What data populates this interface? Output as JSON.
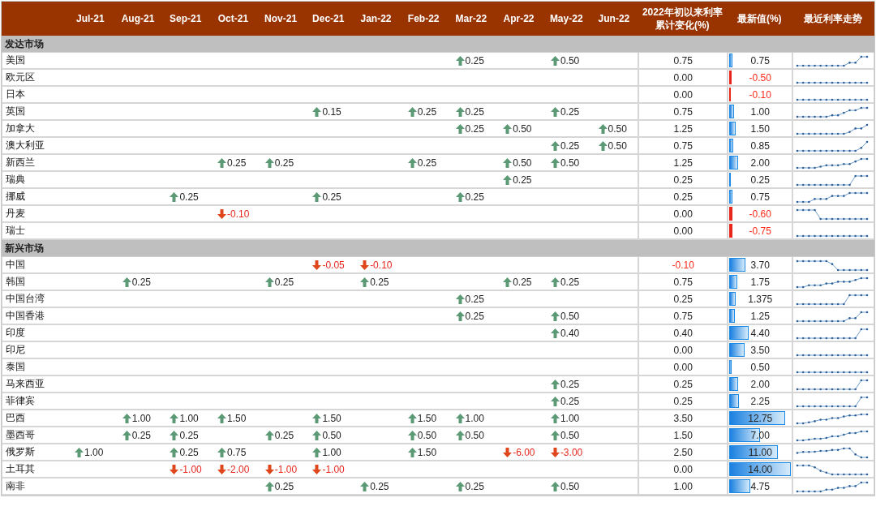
{
  "months": [
    "Jul-21",
    "Aug-21",
    "Sep-21",
    "Oct-21",
    "Nov-21",
    "Dec-21",
    "Jan-22",
    "Feb-22",
    "Mar-22",
    "Apr-22",
    "May-22",
    "Jun-22"
  ],
  "change_header": "2022年初以来利率累计变化(%)",
  "latest_header": "最新值(%)",
  "trend_header": "最近利率走势",
  "sections": [
    {
      "title": "发达市场",
      "rows": [
        {
          "name": "美国",
          "moves": [
            {
              "kind": "none"
            },
            {
              "kind": "none"
            },
            {
              "kind": "none"
            },
            {
              "kind": "none"
            },
            {
              "kind": "none"
            },
            {
              "kind": "none"
            },
            {
              "kind": "none"
            },
            {
              "kind": "none"
            },
            {
              "kind": "rise",
              "value": "0.25"
            },
            {
              "kind": "none"
            },
            {
              "kind": "rise",
              "value": "0.50"
            },
            {
              "kind": "none"
            }
          ],
          "change": {
            "text": "0.75",
            "negative": false
          },
          "latest": {
            "text": "0.75",
            "negative": false,
            "level": 0.054
          }
        },
        {
          "name": "欧元区",
          "moves": [
            {
              "kind": "none"
            },
            {
              "kind": "none"
            },
            {
              "kind": "none"
            },
            {
              "kind": "none"
            },
            {
              "kind": "none"
            },
            {
              "kind": "none"
            },
            {
              "kind": "none"
            },
            {
              "kind": "none"
            },
            {
              "kind": "none"
            },
            {
              "kind": "none"
            },
            {
              "kind": "none"
            },
            {
              "kind": "none"
            }
          ],
          "change": {
            "text": "0.00",
            "negative": false
          },
          "latest": {
            "text": "-0.50",
            "negative": true,
            "level": 0.036
          }
        },
        {
          "name": "日本",
          "moves": [
            {
              "kind": "none"
            },
            {
              "kind": "none"
            },
            {
              "kind": "none"
            },
            {
              "kind": "none"
            },
            {
              "kind": "none"
            },
            {
              "kind": "none"
            },
            {
              "kind": "none"
            },
            {
              "kind": "none"
            },
            {
              "kind": "none"
            },
            {
              "kind": "none"
            },
            {
              "kind": "none"
            },
            {
              "kind": "none"
            }
          ],
          "change": {
            "text": "0.00",
            "negative": false
          },
          "latest": {
            "text": "-0.10",
            "negative": true,
            "level": 0.012
          }
        },
        {
          "name": "英国",
          "moves": [
            {
              "kind": "none"
            },
            {
              "kind": "none"
            },
            {
              "kind": "none"
            },
            {
              "kind": "none"
            },
            {
              "kind": "none"
            },
            {
              "kind": "rise",
              "value": "0.15"
            },
            {
              "kind": "none"
            },
            {
              "kind": "rise",
              "value": "0.25"
            },
            {
              "kind": "rise",
              "value": "0.25"
            },
            {
              "kind": "none"
            },
            {
              "kind": "rise",
              "value": "0.25"
            },
            {
              "kind": "none"
            }
          ],
          "change": {
            "text": "0.75",
            "negative": false
          },
          "latest": {
            "text": "1.00",
            "negative": false,
            "level": 0.071
          }
        },
        {
          "name": "加拿大",
          "moves": [
            {
              "kind": "none"
            },
            {
              "kind": "none"
            },
            {
              "kind": "none"
            },
            {
              "kind": "none"
            },
            {
              "kind": "none"
            },
            {
              "kind": "none"
            },
            {
              "kind": "none"
            },
            {
              "kind": "none"
            },
            {
              "kind": "rise",
              "value": "0.25"
            },
            {
              "kind": "rise",
              "value": "0.50"
            },
            {
              "kind": "none"
            },
            {
              "kind": "rise",
              "value": "0.50"
            }
          ],
          "change": {
            "text": "1.25",
            "negative": false
          },
          "latest": {
            "text": "1.50",
            "negative": false,
            "level": 0.107
          }
        },
        {
          "name": "澳大利亚",
          "moves": [
            {
              "kind": "none"
            },
            {
              "kind": "none"
            },
            {
              "kind": "none"
            },
            {
              "kind": "none"
            },
            {
              "kind": "none"
            },
            {
              "kind": "none"
            },
            {
              "kind": "none"
            },
            {
              "kind": "none"
            },
            {
              "kind": "none"
            },
            {
              "kind": "none"
            },
            {
              "kind": "rise",
              "value": "0.25"
            },
            {
              "kind": "rise",
              "value": "0.50"
            }
          ],
          "change": {
            "text": "0.75",
            "negative": false
          },
          "latest": {
            "text": "0.85",
            "negative": false,
            "level": 0.061
          }
        },
        {
          "name": "新西兰",
          "moves": [
            {
              "kind": "none"
            },
            {
              "kind": "none"
            },
            {
              "kind": "none"
            },
            {
              "kind": "rise",
              "value": "0.25"
            },
            {
              "kind": "rise",
              "value": "0.25"
            },
            {
              "kind": "none"
            },
            {
              "kind": "none"
            },
            {
              "kind": "rise",
              "value": "0.25"
            },
            {
              "kind": "none"
            },
            {
              "kind": "rise",
              "value": "0.50"
            },
            {
              "kind": "rise",
              "value": "0.50"
            },
            {
              "kind": "none"
            }
          ],
          "change": {
            "text": "1.25",
            "negative": false
          },
          "latest": {
            "text": "2.00",
            "negative": false,
            "level": 0.143
          }
        },
        {
          "name": "瑞典",
          "moves": [
            {
              "kind": "none"
            },
            {
              "kind": "none"
            },
            {
              "kind": "none"
            },
            {
              "kind": "none"
            },
            {
              "kind": "none"
            },
            {
              "kind": "none"
            },
            {
              "kind": "none"
            },
            {
              "kind": "none"
            },
            {
              "kind": "none"
            },
            {
              "kind": "rise",
              "value": "0.25"
            },
            {
              "kind": "none"
            },
            {
              "kind": "none"
            }
          ],
          "change": {
            "text": "0.25",
            "negative": false
          },
          "latest": {
            "text": "0.25",
            "negative": false,
            "level": 0.018
          }
        },
        {
          "name": "挪威",
          "moves": [
            {
              "kind": "none"
            },
            {
              "kind": "none"
            },
            {
              "kind": "rise",
              "value": "0.25"
            },
            {
              "kind": "none"
            },
            {
              "kind": "none"
            },
            {
              "kind": "rise",
              "value": "0.25"
            },
            {
              "kind": "none"
            },
            {
              "kind": "none"
            },
            {
              "kind": "rise",
              "value": "0.25"
            },
            {
              "kind": "none"
            },
            {
              "kind": "none"
            },
            {
              "kind": "none"
            }
          ],
          "change": {
            "text": "0.25",
            "negative": false
          },
          "latest": {
            "text": "0.75",
            "negative": false,
            "level": 0.054
          }
        },
        {
          "name": "丹麦",
          "moves": [
            {
              "kind": "none"
            },
            {
              "kind": "none"
            },
            {
              "kind": "none"
            },
            {
              "kind": "cut",
              "value": "-0.10"
            },
            {
              "kind": "none"
            },
            {
              "kind": "none"
            },
            {
              "kind": "none"
            },
            {
              "kind": "none"
            },
            {
              "kind": "none"
            },
            {
              "kind": "none"
            },
            {
              "kind": "none"
            },
            {
              "kind": "none"
            }
          ],
          "change": {
            "text": "0.00",
            "negative": false
          },
          "latest": {
            "text": "-0.60",
            "negative": true,
            "level": 0.043
          }
        },
        {
          "name": "瑞士",
          "moves": [
            {
              "kind": "none"
            },
            {
              "kind": "none"
            },
            {
              "kind": "none"
            },
            {
              "kind": "none"
            },
            {
              "kind": "none"
            },
            {
              "kind": "none"
            },
            {
              "kind": "none"
            },
            {
              "kind": "none"
            },
            {
              "kind": "none"
            },
            {
              "kind": "none"
            },
            {
              "kind": "none"
            },
            {
              "kind": "none"
            }
          ],
          "change": {
            "text": "0.00",
            "negative": false
          },
          "latest": {
            "text": "-0.75",
            "negative": true,
            "level": 0.054
          }
        }
      ]
    },
    {
      "title": "新兴市场",
      "rows": [
        {
          "name": "中国",
          "moves": [
            {
              "kind": "none"
            },
            {
              "kind": "none"
            },
            {
              "kind": "none"
            },
            {
              "kind": "none"
            },
            {
              "kind": "none"
            },
            {
              "kind": "cut",
              "value": "-0.05"
            },
            {
              "kind": "cut",
              "value": "-0.10"
            },
            {
              "kind": "none"
            },
            {
              "kind": "none"
            },
            {
              "kind": "none"
            },
            {
              "kind": "none"
            },
            {
              "kind": "none"
            }
          ],
          "change": {
            "text": "-0.10",
            "negative": true
          },
          "latest": {
            "text": "3.70",
            "negative": false,
            "level": 0.264
          }
        },
        {
          "name": "韩国",
          "moves": [
            {
              "kind": "none"
            },
            {
              "kind": "rise",
              "value": "0.25"
            },
            {
              "kind": "none"
            },
            {
              "kind": "none"
            },
            {
              "kind": "rise",
              "value": "0.25"
            },
            {
              "kind": "none"
            },
            {
              "kind": "rise",
              "value": "0.25"
            },
            {
              "kind": "none"
            },
            {
              "kind": "none"
            },
            {
              "kind": "rise",
              "value": "0.25"
            },
            {
              "kind": "rise",
              "value": "0.25"
            },
            {
              "kind": "none"
            }
          ],
          "change": {
            "text": "0.75",
            "negative": false
          },
          "latest": {
            "text": "1.75",
            "negative": false,
            "level": 0.125
          }
        },
        {
          "name": "中国台湾",
          "moves": [
            {
              "kind": "none"
            },
            {
              "kind": "none"
            },
            {
              "kind": "none"
            },
            {
              "kind": "none"
            },
            {
              "kind": "none"
            },
            {
              "kind": "none"
            },
            {
              "kind": "none"
            },
            {
              "kind": "none"
            },
            {
              "kind": "rise",
              "value": "0.25"
            },
            {
              "kind": "none"
            },
            {
              "kind": "none"
            },
            {
              "kind": "none"
            }
          ],
          "change": {
            "text": "0.25",
            "negative": false
          },
          "latest": {
            "text": "1.375",
            "negative": false,
            "level": 0.098
          }
        },
        {
          "name": "中国香港",
          "moves": [
            {
              "kind": "none"
            },
            {
              "kind": "none"
            },
            {
              "kind": "none"
            },
            {
              "kind": "none"
            },
            {
              "kind": "none"
            },
            {
              "kind": "none"
            },
            {
              "kind": "none"
            },
            {
              "kind": "none"
            },
            {
              "kind": "rise",
              "value": "0.25"
            },
            {
              "kind": "none"
            },
            {
              "kind": "rise",
              "value": "0.50"
            },
            {
              "kind": "none"
            }
          ],
          "change": {
            "text": "0.75",
            "negative": false
          },
          "latest": {
            "text": "1.25",
            "negative": false,
            "level": 0.089
          }
        },
        {
          "name": "印度",
          "moves": [
            {
              "kind": "none"
            },
            {
              "kind": "none"
            },
            {
              "kind": "none"
            },
            {
              "kind": "none"
            },
            {
              "kind": "none"
            },
            {
              "kind": "none"
            },
            {
              "kind": "none"
            },
            {
              "kind": "none"
            },
            {
              "kind": "none"
            },
            {
              "kind": "none"
            },
            {
              "kind": "rise",
              "value": "0.40"
            },
            {
              "kind": "none"
            }
          ],
          "change": {
            "text": "0.40",
            "negative": false
          },
          "latest": {
            "text": "4.40",
            "negative": false,
            "level": 0.314
          }
        },
        {
          "name": "印尼",
          "moves": [
            {
              "kind": "none"
            },
            {
              "kind": "none"
            },
            {
              "kind": "none"
            },
            {
              "kind": "none"
            },
            {
              "kind": "none"
            },
            {
              "kind": "none"
            },
            {
              "kind": "none"
            },
            {
              "kind": "none"
            },
            {
              "kind": "none"
            },
            {
              "kind": "none"
            },
            {
              "kind": "none"
            },
            {
              "kind": "none"
            }
          ],
          "change": {
            "text": "0.00",
            "negative": false
          },
          "latest": {
            "text": "3.50",
            "negative": false,
            "level": 0.25
          }
        },
        {
          "name": "泰国",
          "moves": [
            {
              "kind": "none"
            },
            {
              "kind": "none"
            },
            {
              "kind": "none"
            },
            {
              "kind": "none"
            },
            {
              "kind": "none"
            },
            {
              "kind": "none"
            },
            {
              "kind": "none"
            },
            {
              "kind": "none"
            },
            {
              "kind": "none"
            },
            {
              "kind": "none"
            },
            {
              "kind": "none"
            },
            {
              "kind": "none"
            }
          ],
          "change": {
            "text": "0.00",
            "negative": false
          },
          "latest": {
            "text": "0.50",
            "negative": false,
            "level": 0.036
          }
        },
        {
          "name": "马来西亚",
          "moves": [
            {
              "kind": "none"
            },
            {
              "kind": "none"
            },
            {
              "kind": "none"
            },
            {
              "kind": "none"
            },
            {
              "kind": "none"
            },
            {
              "kind": "none"
            },
            {
              "kind": "none"
            },
            {
              "kind": "none"
            },
            {
              "kind": "none"
            },
            {
              "kind": "none"
            },
            {
              "kind": "rise",
              "value": "0.25"
            },
            {
              "kind": "none"
            }
          ],
          "change": {
            "text": "0.25",
            "negative": false
          },
          "latest": {
            "text": "2.00",
            "negative": false,
            "level": 0.143
          }
        },
        {
          "name": "菲律宾",
          "moves": [
            {
              "kind": "none"
            },
            {
              "kind": "none"
            },
            {
              "kind": "none"
            },
            {
              "kind": "none"
            },
            {
              "kind": "none"
            },
            {
              "kind": "none"
            },
            {
              "kind": "none"
            },
            {
              "kind": "none"
            },
            {
              "kind": "none"
            },
            {
              "kind": "none"
            },
            {
              "kind": "rise",
              "value": "0.25"
            },
            {
              "kind": "none"
            }
          ],
          "change": {
            "text": "0.25",
            "negative": false
          },
          "latest": {
            "text": "2.25",
            "negative": false,
            "level": 0.161
          }
        },
        {
          "name": "巴西",
          "moves": [
            {
              "kind": "none"
            },
            {
              "kind": "rise",
              "value": "1.00"
            },
            {
              "kind": "rise",
              "value": "1.00"
            },
            {
              "kind": "rise",
              "value": "1.50"
            },
            {
              "kind": "none"
            },
            {
              "kind": "rise",
              "value": "1.50"
            },
            {
              "kind": "none"
            },
            {
              "kind": "rise",
              "value": "1.50"
            },
            {
              "kind": "rise",
              "value": "1.00"
            },
            {
              "kind": "none"
            },
            {
              "kind": "rise",
              "value": "1.00"
            },
            {
              "kind": "none"
            }
          ],
          "change": {
            "text": "3.50",
            "negative": false
          },
          "latest": {
            "text": "12.75",
            "negative": false,
            "level": 0.911
          }
        },
        {
          "name": "墨西哥",
          "moves": [
            {
              "kind": "none"
            },
            {
              "kind": "rise",
              "value": "0.25"
            },
            {
              "kind": "rise",
              "value": "0.25"
            },
            {
              "kind": "none"
            },
            {
              "kind": "rise",
              "value": "0.25"
            },
            {
              "kind": "rise",
              "value": "0.50"
            },
            {
              "kind": "none"
            },
            {
              "kind": "rise",
              "value": "0.50"
            },
            {
              "kind": "rise",
              "value": "0.50"
            },
            {
              "kind": "none"
            },
            {
              "kind": "rise",
              "value": "0.50"
            },
            {
              "kind": "none"
            }
          ],
          "change": {
            "text": "1.50",
            "negative": false
          },
          "latest": {
            "text": "7.00",
            "negative": false,
            "level": 0.5
          }
        },
        {
          "name": "俄罗斯",
          "moves": [
            {
              "kind": "rise",
              "value": "1.00"
            },
            {
              "kind": "none"
            },
            {
              "kind": "rise",
              "value": "0.25"
            },
            {
              "kind": "rise",
              "value": "0.75"
            },
            {
              "kind": "none"
            },
            {
              "kind": "rise",
              "value": "1.00"
            },
            {
              "kind": "none"
            },
            {
              "kind": "rise",
              "value": "1.50"
            },
            {
              "kind": "none"
            },
            {
              "kind": "cut",
              "value": "-6.00"
            },
            {
              "kind": "cut",
              "value": "-3.00"
            },
            {
              "kind": "none"
            }
          ],
          "change": {
            "text": "2.50",
            "negative": false
          },
          "latest": {
            "text": "11.00",
            "negative": false,
            "level": 0.786
          }
        },
        {
          "name": "土耳其",
          "moves": [
            {
              "kind": "none"
            },
            {
              "kind": "none"
            },
            {
              "kind": "cut",
              "value": "-1.00"
            },
            {
              "kind": "cut",
              "value": "-2.00"
            },
            {
              "kind": "cut",
              "value": "-1.00"
            },
            {
              "kind": "cut",
              "value": "-1.00"
            },
            {
              "kind": "none"
            },
            {
              "kind": "none"
            },
            {
              "kind": "none"
            },
            {
              "kind": "none"
            },
            {
              "kind": "none"
            },
            {
              "kind": "none"
            }
          ],
          "change": {
            "text": "0.00",
            "negative": false
          },
          "latest": {
            "text": "14.00",
            "negative": false,
            "level": 1
          }
        },
        {
          "name": "南非",
          "moves": [
            {
              "kind": "none"
            },
            {
              "kind": "none"
            },
            {
              "kind": "none"
            },
            {
              "kind": "none"
            },
            {
              "kind": "rise",
              "value": "0.25"
            },
            {
              "kind": "none"
            },
            {
              "kind": "rise",
              "value": "0.25"
            },
            {
              "kind": "none"
            },
            {
              "kind": "rise",
              "value": "0.25"
            },
            {
              "kind": "none"
            },
            {
              "kind": "rise",
              "value": "0.50"
            },
            {
              "kind": "none"
            }
          ],
          "change": {
            "text": "1.00",
            "negative": false
          },
          "latest": {
            "text": "4.75",
            "negative": false,
            "level": 0.339
          }
        }
      ]
    }
  ]
}
